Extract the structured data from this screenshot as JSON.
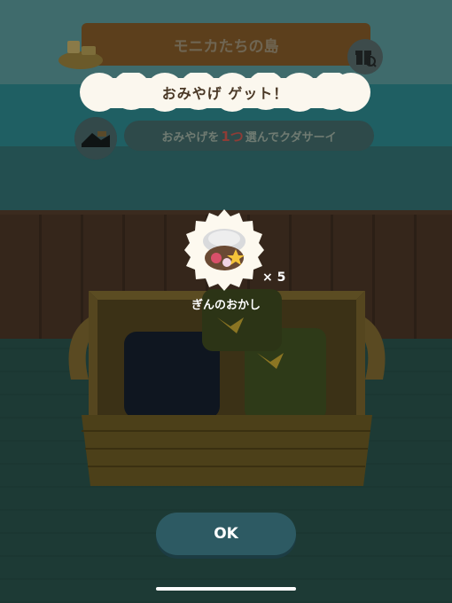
{
  "header": {
    "island_name": "モニカたちの島"
  },
  "popup": {
    "title": "おみやげ ゲット！",
    "instruction_before": "おみやげを",
    "instruction_count": "1つ",
    "instruction_after": "選んでクダサーイ"
  },
  "reward": {
    "name": "ぎんのおかし",
    "quantity": "× 5"
  },
  "actions": {
    "ok_label": "OK"
  },
  "colors": {
    "overlay_dark": "#243c3e",
    "button": "#2d5a63",
    "banner_text": "#4a3826",
    "highlight": "#8e3c36"
  },
  "icons": [
    "gift-search-icon",
    "island-icon",
    "silver-candy-icon",
    "character-avatar-icon"
  ]
}
